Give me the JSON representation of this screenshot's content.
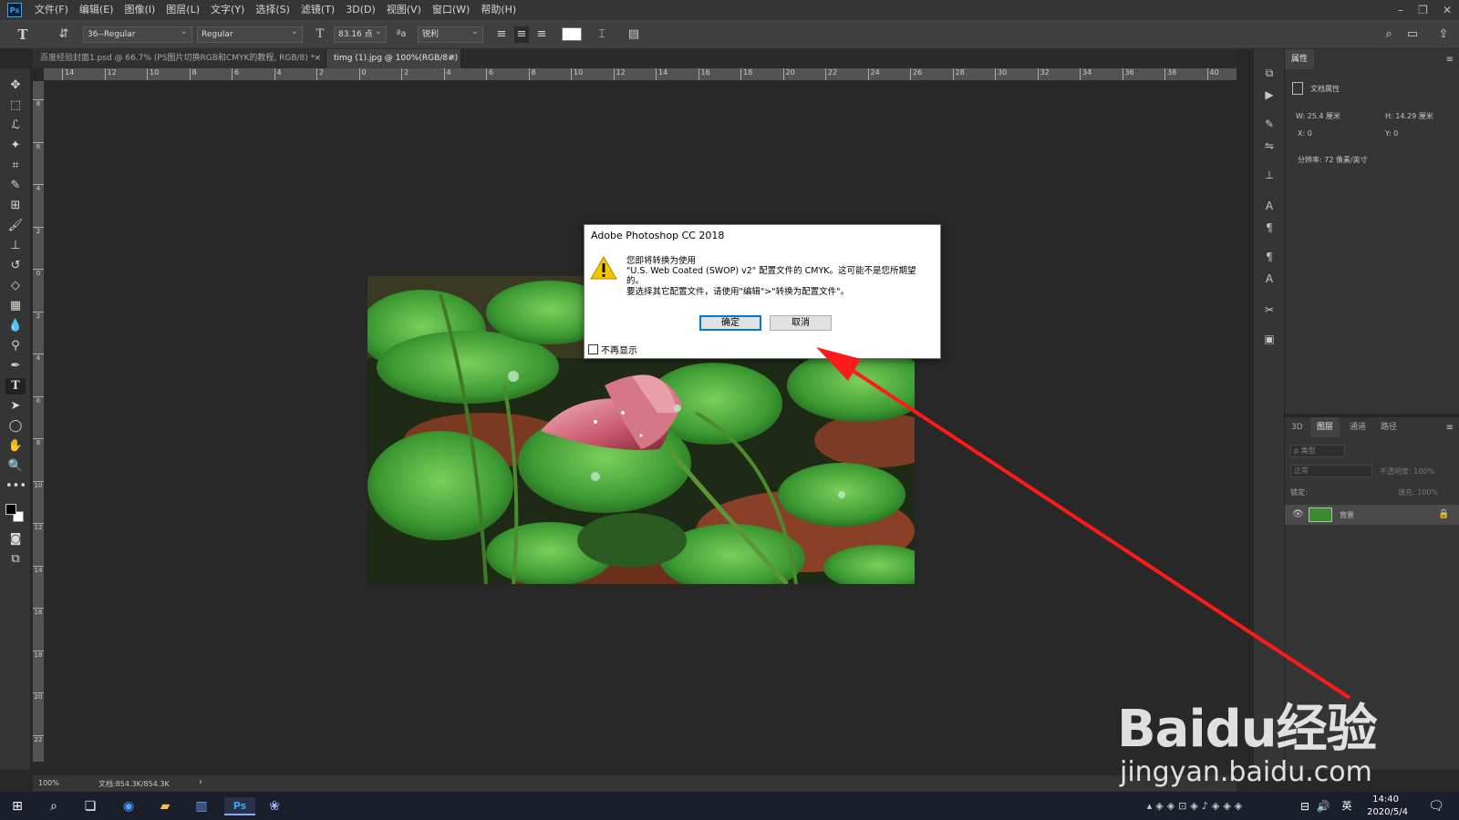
{
  "menubar": {
    "logo": "Ps",
    "items": [
      "文件(F)",
      "编辑(E)",
      "图像(I)",
      "图层(L)",
      "文字(Y)",
      "选择(S)",
      "滤镜(T)",
      "3D(D)",
      "视图(V)",
      "窗口(W)",
      "帮助(H)"
    ]
  },
  "options": {
    "font_family": "36--Regular",
    "font_style": "Regular",
    "font_size": "83.16 点",
    "antialias": "锐利"
  },
  "tabs": [
    {
      "label": "百度经验封面1.psd @ 66.7% (PS图片切换RGB和CMYK的教程, RGB/8) *",
      "close": "×"
    },
    {
      "label": "timg (1).jpg @ 100%(RGB/8#)",
      "close": "×"
    }
  ],
  "ruler": {
    "h_ticks": [
      "14",
      "12",
      "10",
      "8",
      "6",
      "4",
      "2",
      "0",
      "2",
      "4",
      "6",
      "8",
      "10",
      "12",
      "14",
      "16",
      "18",
      "20",
      "22",
      "24",
      "26",
      "28",
      "30",
      "32",
      "34",
      "36",
      "38",
      "40"
    ],
    "v_ticks": [
      "8",
      "6",
      "4",
      "2",
      "0",
      "2",
      "4",
      "6",
      "8",
      "10",
      "12",
      "14",
      "16",
      "18",
      "20",
      "22"
    ]
  },
  "properties": {
    "tab": "属性",
    "section": "文档属性",
    "w": "W: 25.4 厘米",
    "h": "H: 14.29 厘米",
    "x": "X: 0",
    "y": "Y: 0",
    "resolution": "分辨率: 72 像素/英寸"
  },
  "layers": {
    "tabs": [
      "3D",
      "图层",
      "通道",
      "路径"
    ],
    "filter": "ρ 类型",
    "blend": "正常",
    "opacity": "不透明度: 100%",
    "lock": "锁定:",
    "fill": "填充: 100%",
    "layer_name": "背景"
  },
  "status": {
    "zoom": "100%",
    "doc": "文档:854.3K/854.3K"
  },
  "dialog": {
    "title": "Adobe Photoshop CC 2018",
    "line1": "您即将转换为使用",
    "line2": "\"U.S. Web Coated (SWOP) v2\" 配置文件的 CMYK。这可能不是您所期望",
    "line3": "的。",
    "line4": "要选择其它配置文件，请使用\"编辑\">\"转换为配置文件\"。",
    "ok": "确定",
    "cancel": "取消",
    "checkbox": "不再显示"
  },
  "taskbar": {
    "time": "14:40",
    "date": "2020/5/4",
    "lang": "英"
  },
  "watermark": {
    "logo": "Baidu经验",
    "url": "jingyan.baidu.com"
  },
  "colors": {
    "annotation_arrow": "#ff1a1a",
    "dialog_default_border": "#0078d7",
    "warning": "#f5c400"
  }
}
